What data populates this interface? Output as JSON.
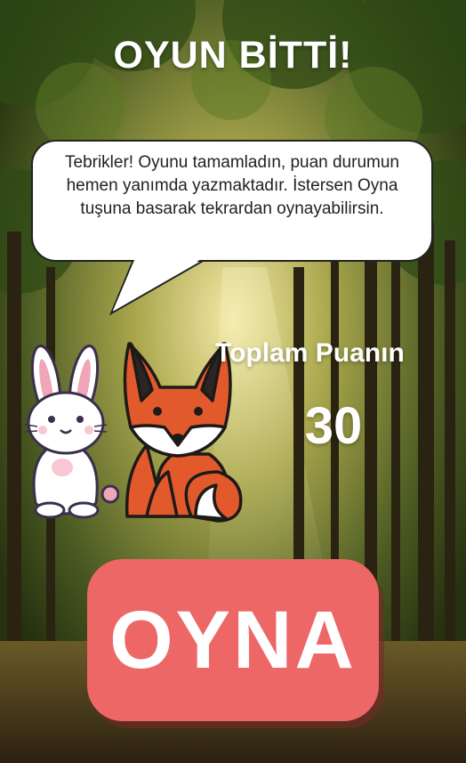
{
  "screen": {
    "title": "OYUN BİTTİ!",
    "message": "Tebrikler! Oyunu tamamladın, puan durumun hemen yanımda yazmaktadır. İstersen Oyna tuşuna basarak tekrardan oynayabilirsin.",
    "score_label": "Toplam Puanın",
    "score_value": "30",
    "play_button_label": "OYNA"
  },
  "characters": {
    "left": "rabbit",
    "right": "fox"
  },
  "colors": {
    "button": "#ee6767",
    "title_text": "#ffffff",
    "bubble": "#ffffff",
    "fox": "#e25a2c",
    "rabbit_ear_inner": "#f0a6b8"
  }
}
